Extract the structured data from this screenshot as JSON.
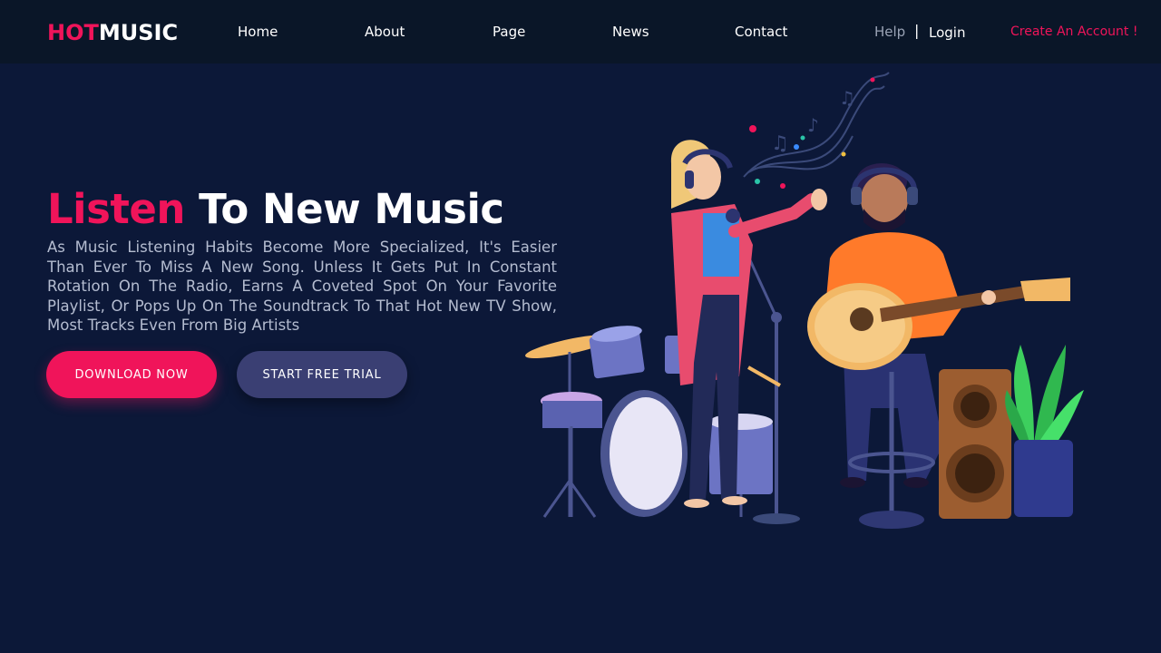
{
  "brand": {
    "hot": "HOT",
    "music": "MUSIC"
  },
  "nav": {
    "home": "Home",
    "about": "About",
    "page": "Page",
    "news": "News",
    "contact": "Contact",
    "help": "Help",
    "separator": "|",
    "login": "Login",
    "create_account": "Create An Account !"
  },
  "hero": {
    "title_highlight": "Listen",
    "title_rest": " To New Music",
    "description": "As Music Listening Habits Become More Specialized, It's Easier Than Ever To Miss A New Song. Unless It Gets Put In Constant Rotation On The Radio, Earns A Coveted Spot On Your Favorite Playlist, Or Pops Up On The Soundtrack To That Hot New TV Show, Most Tracks Even From Big Artists",
    "download_label": "DOWNLOAD NOW",
    "trial_label": "START FREE TRIAL"
  },
  "colors": {
    "accent": "#f0145a",
    "background": "#0c1838",
    "navbar": "#0a1628",
    "secondary_button": "#3a3f73"
  },
  "icons": {
    "illustration": "band-illustration"
  }
}
